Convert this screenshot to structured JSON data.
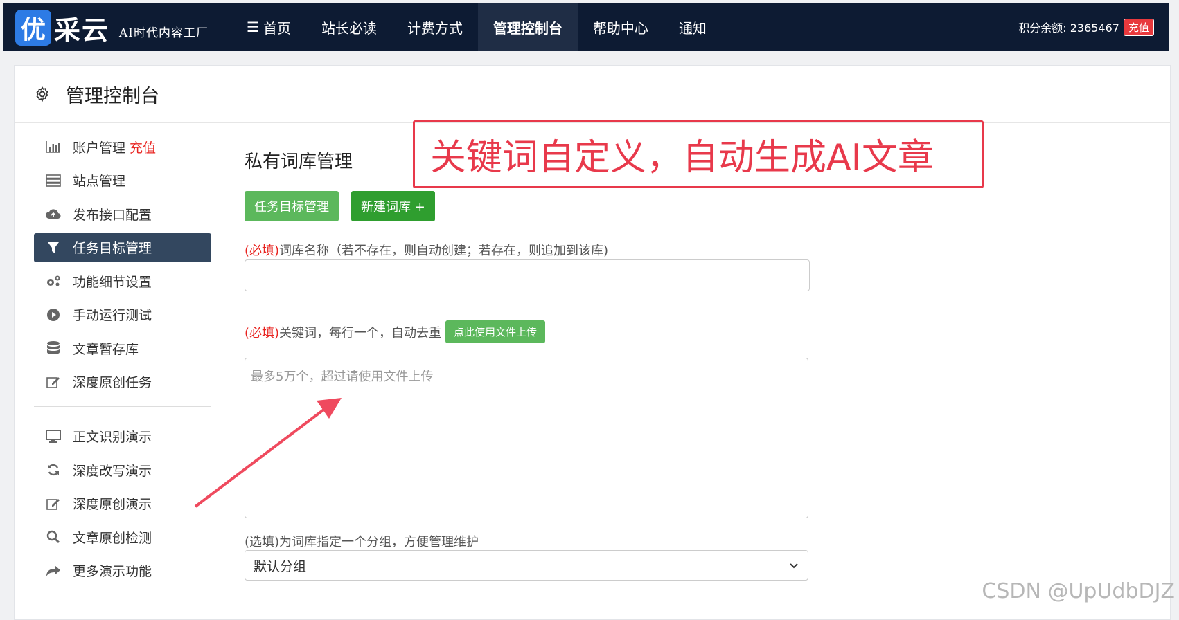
{
  "header": {
    "logo_char": "优",
    "logo_rest": "采云",
    "slogan": "AI时代内容工厂",
    "nav": [
      {
        "label": "首页",
        "icon": "menu-icon"
      },
      {
        "label": "站长必读"
      },
      {
        "label": "计费方式"
      },
      {
        "label": "管理控制台"
      },
      {
        "label": "帮助中心"
      },
      {
        "label": "通知"
      }
    ],
    "points_text": "积分余额: 2365467",
    "recharge_label": "充值"
  },
  "panel": {
    "title": "管理控制台",
    "icon": "gear-icon"
  },
  "sidebar": {
    "items": [
      {
        "label": "账户管理",
        "extra": "充值",
        "icon": "bar-chart-icon"
      },
      {
        "label": "站点管理",
        "icon": "server-icon"
      },
      {
        "label": "发布接口配置",
        "icon": "cloud-upload-icon"
      },
      {
        "label": "任务目标管理",
        "icon": "filter-icon"
      },
      {
        "label": "功能细节设置",
        "icon": "cogs-icon"
      },
      {
        "label": "手动运行测试",
        "icon": "play-circle-icon"
      },
      {
        "label": "文章暂存库",
        "icon": "database-icon"
      },
      {
        "label": "深度原创任务",
        "icon": "edit-icon"
      },
      {
        "label": "正文识别演示",
        "icon": "monitor-icon"
      },
      {
        "label": "深度改写演示",
        "icon": "refresh-icon"
      },
      {
        "label": "深度原创演示",
        "icon": "edit-icon"
      },
      {
        "label": "文章原创检测",
        "icon": "search-icon"
      },
      {
        "label": "更多演示功能",
        "icon": "share-icon"
      }
    ]
  },
  "main": {
    "section_title": "私有词库管理",
    "btn_task_target": "任务目标管理",
    "btn_new_lib": "新建词库 +",
    "required_tag": "(必填)",
    "lib_name_label": "词库名称（若不存在，则自动创建；若存在，则追加到该库)",
    "keywords_label": "关键词，每行一个，自动去重",
    "upload_btn": "点此使用文件上传",
    "keywords_placeholder": "最多5万个，超过请使用文件上传",
    "group_label": "(选填)为词库指定一个分组，方便管理维护",
    "group_selected": "默认分组"
  },
  "annotation": {
    "callout_text": "关键词自定义，自动生成AI文章",
    "color": "#e8394b"
  },
  "watermark": "CSDN @UpUdbDJZ"
}
